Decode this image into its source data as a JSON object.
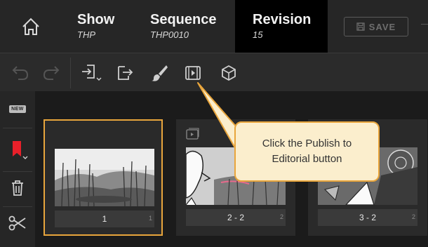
{
  "header": {
    "home_icon": "home-icon",
    "breadcrumbs": [
      {
        "title": "Show",
        "value": "THP"
      },
      {
        "title": "Sequence",
        "value": "THP0010"
      },
      {
        "title": "Revision",
        "value": "15"
      }
    ],
    "save_label": "SAVE"
  },
  "toolbar": {
    "icons": [
      "undo-icon",
      "redo-icon",
      "import-icon",
      "export-icon",
      "brush-icon",
      "publish-to-editorial-icon",
      "3d-cube-icon"
    ]
  },
  "rail": {
    "new_label": "NEW",
    "icons": [
      "new-panel-icon",
      "bookmark-icon",
      "trash-icon",
      "scissors-icon"
    ],
    "accent": "#e8202a"
  },
  "panels": [
    {
      "label": "1",
      "sub": "1",
      "selected": true
    },
    {
      "label": "2 - 2",
      "sub": "2",
      "selected": false
    },
    {
      "label": "3 - 2",
      "sub": "2",
      "selected": false
    }
  ],
  "callout": {
    "text": "Click the Publish to Editorial button"
  },
  "colors": {
    "highlight": "#e8a53c",
    "callout_bg": "#fbeecd"
  }
}
